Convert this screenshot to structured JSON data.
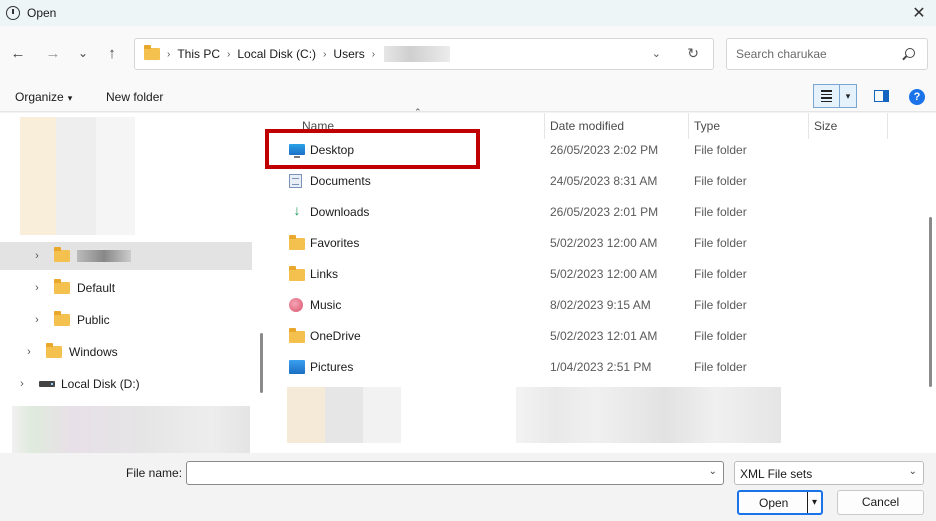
{
  "window": {
    "title": "Open",
    "close_glyph": "✕"
  },
  "nav": {
    "back_glyph": "←",
    "forward_glyph": "→",
    "recent_glyph": "⌄",
    "up_glyph": "↑",
    "breadcrumbs": [
      "This PC",
      "Local Disk (C:)",
      "Users"
    ],
    "separator": "›",
    "dropdown_glyph": "⌄",
    "refresh_glyph": "↻",
    "search_placeholder": "Search charukae"
  },
  "toolbar": {
    "organize_label": "Organize",
    "organize_caret": "▾",
    "new_folder_label": "New folder",
    "view_caret": "▾",
    "help_glyph": "?"
  },
  "tree": {
    "items": [
      {
        "label": "",
        "redacted": true,
        "icon": "folder-icon",
        "chevron": "›"
      },
      {
        "label": "Default",
        "icon": "folder-icon",
        "chevron": "›"
      },
      {
        "label": "Public",
        "icon": "folder-icon",
        "chevron": "›"
      },
      {
        "label": "Windows",
        "icon": "folder-icon",
        "chevron": "›"
      },
      {
        "label": "Local Disk (D:)",
        "icon": "drive-icon",
        "chevron": "›"
      }
    ]
  },
  "filelist": {
    "columns": [
      "Name",
      "Date modified",
      "Type",
      "Size"
    ],
    "sort_caret": "⌃",
    "rows": [
      {
        "name": "Desktop",
        "date": "26/05/2023 2:02 PM",
        "type": "File folder",
        "icon": "desktop-icon"
      },
      {
        "name": "Documents",
        "date": "24/05/2023 8:31 AM",
        "type": "File folder",
        "icon": "documents-icon"
      },
      {
        "name": "Downloads",
        "date": "26/05/2023 2:01 PM",
        "type": "File folder",
        "icon": "downloads-icon"
      },
      {
        "name": "Favorites",
        "date": "5/02/2023 12:00 AM",
        "type": "File folder",
        "icon": "folder-icon"
      },
      {
        "name": "Links",
        "date": "5/02/2023 12:00 AM",
        "type": "File folder",
        "icon": "folder-icon"
      },
      {
        "name": "Music",
        "date": "8/02/2023 9:15 AM",
        "type": "File folder",
        "icon": "music-icon"
      },
      {
        "name": "OneDrive",
        "date": "5/02/2023 12:01 AM",
        "type": "File folder",
        "icon": "folder-icon"
      },
      {
        "name": "Pictures",
        "date": "1/04/2023 2:51 PM",
        "type": "File folder",
        "icon": "pictures-icon"
      }
    ],
    "download_glyph": "↓"
  },
  "footer": {
    "file_name_label": "File name:",
    "file_name_value": "",
    "dropdown_glyph": "⌄",
    "filter_value": "XML File sets",
    "open_label": "Open",
    "open_split_glyph": "▾",
    "cancel_label": "Cancel"
  },
  "colors": {
    "highlight": "#c00000",
    "accent": "#1a73e8",
    "folder": "#f4c04e"
  }
}
